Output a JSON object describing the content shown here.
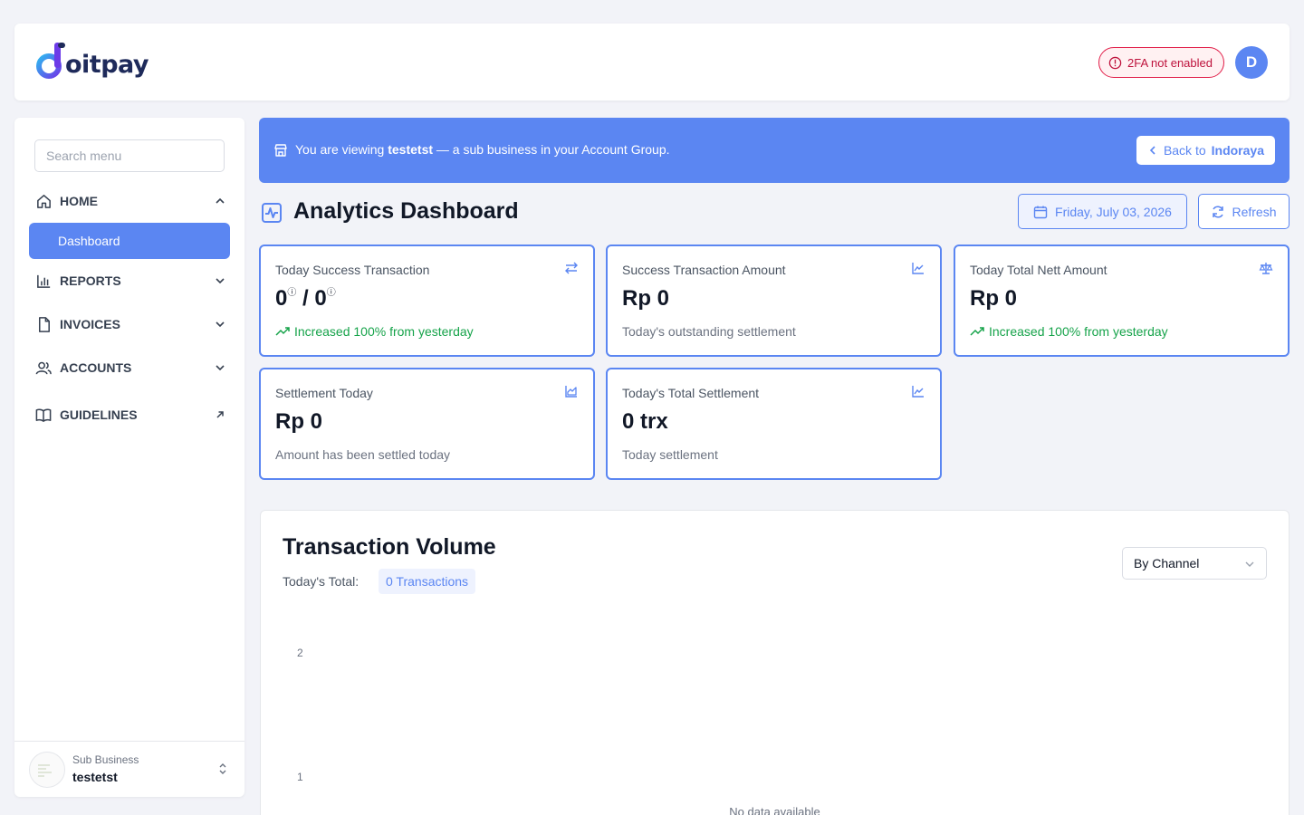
{
  "brand": {
    "logo_text": "oitpay",
    "accent": "#5b86f2"
  },
  "header": {
    "twofa_label": "2FA not enabled",
    "avatar_initial": "D"
  },
  "sidebar": {
    "search_placeholder": "Search menu",
    "items": [
      {
        "label": "HOME",
        "icon": "home-icon",
        "expanded": true
      },
      {
        "label": "REPORTS",
        "icon": "bar-chart-icon"
      },
      {
        "label": "INVOICES",
        "icon": "file-icon"
      },
      {
        "label": "ACCOUNTS",
        "icon": "users-icon"
      },
      {
        "label": "GUIDELINES",
        "icon": "book-icon"
      }
    ],
    "active_subitem": "Dashboard",
    "sub_business": {
      "label": "Sub Business",
      "name": "testetst"
    }
  },
  "banner": {
    "prefix": "You are viewing ",
    "business": "testetst",
    "suffix": " — a sub business in your Account Group.",
    "back_prefix": "Back to ",
    "back_target": "Indoraya"
  },
  "dashboard": {
    "title": "Analytics Dashboard",
    "date": "Friday, July 03, 2026",
    "refresh_label": "Refresh"
  },
  "cards": [
    {
      "label": "Today Success Transaction",
      "value_a": "0",
      "value_b": "0",
      "sub": "Increased 100% from yesterday",
      "icon": "transfer-arrows-icon"
    },
    {
      "label": "Success Transaction Amount",
      "value": "Rp 0",
      "sub": "Today's outstanding settlement",
      "icon": "line-chart-icon"
    },
    {
      "label": "Today Total Nett Amount",
      "value": "Rp 0",
      "sub": "Increased 100% from yesterday",
      "icon": "scale-icon"
    },
    {
      "label": "Settlement Today",
      "value": "Rp 0",
      "sub": "Amount has been settled today",
      "icon": "area-chart-icon"
    },
    {
      "label": "Today's Total Settlement",
      "value": "0 trx",
      "sub": "Today settlement",
      "icon": "line-chart-icon"
    }
  ],
  "volume": {
    "title": "Transaction Volume",
    "total_label": "Today's Total:",
    "total_value": "0 Transactions",
    "channel_selected": "By Channel",
    "empty_text": "No data available"
  },
  "chart_data": {
    "type": "bar",
    "title": "Transaction Volume",
    "categories": [],
    "values": [],
    "yticks": [
      "2",
      "1"
    ],
    "ylim": [
      0,
      2
    ]
  }
}
